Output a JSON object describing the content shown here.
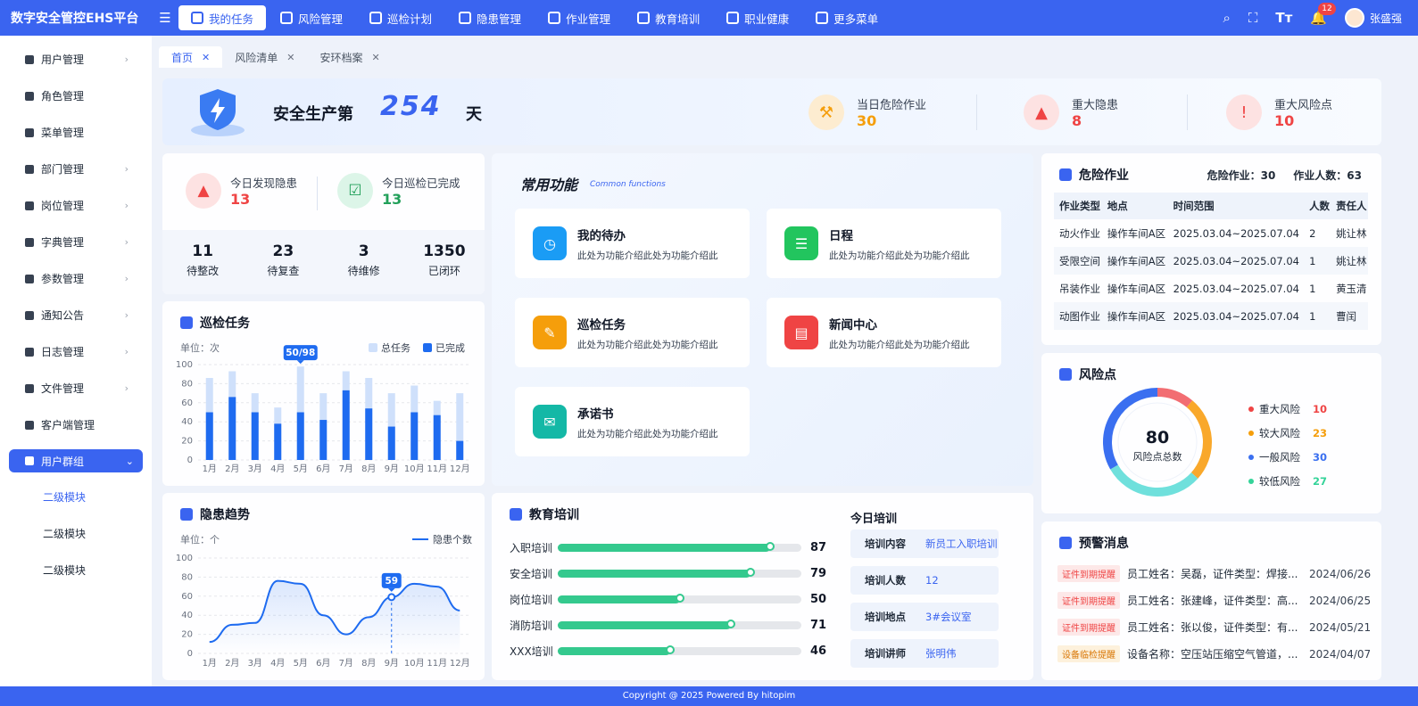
{
  "app": {
    "title": "数字安全管控EHS平台"
  },
  "nav": {
    "items": [
      {
        "label": "我的任务",
        "active": true
      },
      {
        "label": "风险管理"
      },
      {
        "label": "巡检计划"
      },
      {
        "label": "隐患管理"
      },
      {
        "label": "作业管理"
      },
      {
        "label": "教育培训"
      },
      {
        "label": "职业健康"
      },
      {
        "label": "更多菜单"
      }
    ],
    "notification_count": "12",
    "user_name": "张盛强"
  },
  "sidebar": {
    "items": [
      {
        "label": "用户管理",
        "arrow": "›"
      },
      {
        "label": "角色管理",
        "arrow": ""
      },
      {
        "label": "菜单管理",
        "arrow": ""
      },
      {
        "label": "部门管理",
        "arrow": "›"
      },
      {
        "label": "岗位管理",
        "arrow": "›"
      },
      {
        "label": "字典管理",
        "arrow": "›"
      },
      {
        "label": "参数管理",
        "arrow": "›"
      },
      {
        "label": "通知公告",
        "arrow": "›"
      },
      {
        "label": "日志管理",
        "arrow": "›"
      },
      {
        "label": "文件管理",
        "arrow": "›"
      },
      {
        "label": "客户端管理",
        "arrow": ""
      }
    ],
    "active_group": {
      "label": "用户群组",
      "arrow": "⌄"
    },
    "sub_items": [
      "二级模块",
      "二级模块",
      "二级模块"
    ]
  },
  "tabs": [
    {
      "label": "首页",
      "close": "✕"
    },
    {
      "label": "风险清单",
      "close": "✕"
    },
    {
      "label": "安环档案",
      "close": "✕"
    }
  ],
  "banner": {
    "safe_prefix": "安全生产第",
    "safe_days": "254",
    "safe_unit": "天",
    "stats": [
      {
        "label": "当日危险作业",
        "value": "30",
        "color": "#f59e0b"
      },
      {
        "label": "重大隐患",
        "value": "8",
        "color": "#ef4444"
      },
      {
        "label": "重大风险点",
        "value": "10",
        "color": "#ef4444"
      }
    ]
  },
  "today": {
    "found_label": "今日发现隐患",
    "found_value": "13",
    "patrol_label": "今日巡检已完成",
    "patrol_value": "13",
    "counts": [
      {
        "value": "11",
        "label": "待整改"
      },
      {
        "value": "23",
        "label": "待复查"
      },
      {
        "value": "3",
        "label": "待维修"
      },
      {
        "value": "1350",
        "label": "已闭环"
      }
    ]
  },
  "patrol": {
    "title": "巡检任务",
    "unit": "单位：次",
    "legend_total": "总任务",
    "legend_done": "已完成",
    "tooltip": "50/98"
  },
  "trend": {
    "title": "隐患趋势",
    "unit": "单位：个",
    "legend": "隐患个数",
    "tooltip": "59"
  },
  "common": {
    "title": "常用功能",
    "subtitle": "Common functions",
    "items": [
      {
        "name": "我的待办",
        "desc": "此处为功能介绍此处为功能介绍此",
        "color": "#1a9cf5"
      },
      {
        "name": "日程",
        "desc": "此处为功能介绍此处为功能介绍此",
        "color": "#22c55e"
      },
      {
        "name": "巡检任务",
        "desc": "此处为功能介绍此处为功能介绍此",
        "color": "#f59e0b"
      },
      {
        "name": "新闻中心",
        "desc": "此处为功能介绍此处为功能介绍此",
        "color": "#ef4444"
      },
      {
        "name": "承诺书",
        "desc": "此处为功能介绍此处为功能介绍此",
        "color": "#14b8a6"
      }
    ]
  },
  "edu": {
    "title": "教育培训",
    "rows": [
      {
        "label": "入职培训",
        "value": 87
      },
      {
        "label": "安全培训",
        "value": 79
      },
      {
        "label": "岗位培训",
        "value": 50
      },
      {
        "label": "消防培训",
        "value": 71
      },
      {
        "label": "XXX培训",
        "value": 46
      }
    ],
    "today_title": "今日培训",
    "today_rows": [
      {
        "k": "培训内容",
        "v": "新员工入职培训"
      },
      {
        "k": "培训人数",
        "v": "12"
      },
      {
        "k": "培训地点",
        "v": "3#会议室"
      },
      {
        "k": "培训讲师",
        "v": "张明伟"
      }
    ]
  },
  "danger": {
    "title": "危险作业",
    "stat1": "危险作业：30",
    "stat2": "作业人数：63",
    "headers": [
      "作业类型",
      "地点",
      "时间范围",
      "人数",
      "责任人"
    ],
    "rows": [
      [
        "动火作业",
        "操作车间A区",
        "2025.03.04~2025.07.04",
        "2",
        "姚让林"
      ],
      [
        "受限空间",
        "操作车间A区",
        "2025.03.04~2025.07.04",
        "1",
        "姚让林"
      ],
      [
        "吊装作业",
        "操作车间A区",
        "2025.03.04~2025.07.04",
        "1",
        "黄玉清"
      ],
      [
        "动图作业",
        "操作车间A区",
        "2025.03.04~2025.07.04",
        "1",
        "曹闰"
      ]
    ]
  },
  "risk": {
    "title": "风险点",
    "total": "80",
    "total_label": "风险点总数",
    "legend": [
      {
        "name": "重大风险",
        "value": "10",
        "color": "#ef4444"
      },
      {
        "name": "较大风险",
        "value": "23",
        "color": "#f59e0b"
      },
      {
        "name": "一般风险",
        "value": "30",
        "color": "#3a6ff0"
      },
      {
        "name": "较低风险",
        "value": "27",
        "color": "#34d399"
      }
    ],
    "ring_colors": [
      "#f26d72",
      "#f9a82b",
      "#6fe0dc",
      "#3a6ff0"
    ]
  },
  "warn": {
    "title": "预警消息",
    "rows": [
      {
        "tag": "证件到期提醒",
        "msg": "员工姓名：吴磊，证件类型：焊接...",
        "date": "2024/06/26",
        "tag_color": "#ef4444",
        "tag_bg": "#fde8e8"
      },
      {
        "tag": "证件到期提醒",
        "msg": "员工姓名：张建峰，证件类型：高...",
        "date": "2024/06/25",
        "tag_color": "#ef4444",
        "tag_bg": "#fde8e8"
      },
      {
        "tag": "证件到期提醒",
        "msg": "员工姓名：张以俊，证件类型：有...",
        "date": "2024/05/21",
        "tag_color": "#ef4444",
        "tag_bg": "#fde8e8"
      },
      {
        "tag": "设备临检提醒",
        "msg": "设备名称：空压站压缩空气管道，...",
        "date": "2024/04/07",
        "tag_color": "#d97706",
        "tag_bg": "#fdf1dc"
      }
    ]
  },
  "footer": {
    "text": "Copyright @ 2025 Powered By hitopim"
  },
  "chart_data": [
    {
      "type": "bar",
      "title": "巡检任务",
      "ylabel": "单位：次",
      "categories": [
        "1月",
        "2月",
        "3月",
        "4月",
        "5月",
        "6月",
        "7月",
        "8月",
        "9月",
        "10月",
        "11月",
        "12月"
      ],
      "series": [
        {
          "name": "总任务",
          "values": [
            86,
            93,
            70,
            55,
            98,
            70,
            93,
            86,
            70,
            78,
            62,
            70
          ],
          "color": "#cfe0fb"
        },
        {
          "name": "已完成",
          "values": [
            50,
            66,
            50,
            38,
            50,
            42,
            73,
            54,
            35,
            50,
            47,
            20
          ],
          "color": "#1e6bf0"
        }
      ],
      "ylim": [
        0,
        100
      ],
      "yticks": [
        0,
        20,
        40,
        60,
        80,
        100
      ],
      "legend": "top-right"
    },
    {
      "type": "line",
      "title": "隐患趋势",
      "ylabel": "单位：个",
      "categories": [
        "1月",
        "2月",
        "3月",
        "4月",
        "5月",
        "6月",
        "7月",
        "8月",
        "9月",
        "10月",
        "11月",
        "12月"
      ],
      "series": [
        {
          "name": "隐患个数",
          "values": [
            12,
            30,
            32,
            76,
            73,
            40,
            20,
            38,
            59,
            73,
            70,
            45
          ],
          "color": "#1e6bf0"
        }
      ],
      "ylim": [
        0,
        100
      ],
      "yticks": [
        0,
        20,
        40,
        60,
        80,
        100
      ],
      "legend": "top-right"
    },
    {
      "type": "pie",
      "title": "风险点",
      "categories": [
        "重大风险",
        "较大风险",
        "一般风险",
        "较低风险"
      ],
      "values": [
        10,
        23,
        30,
        27
      ]
    }
  ]
}
